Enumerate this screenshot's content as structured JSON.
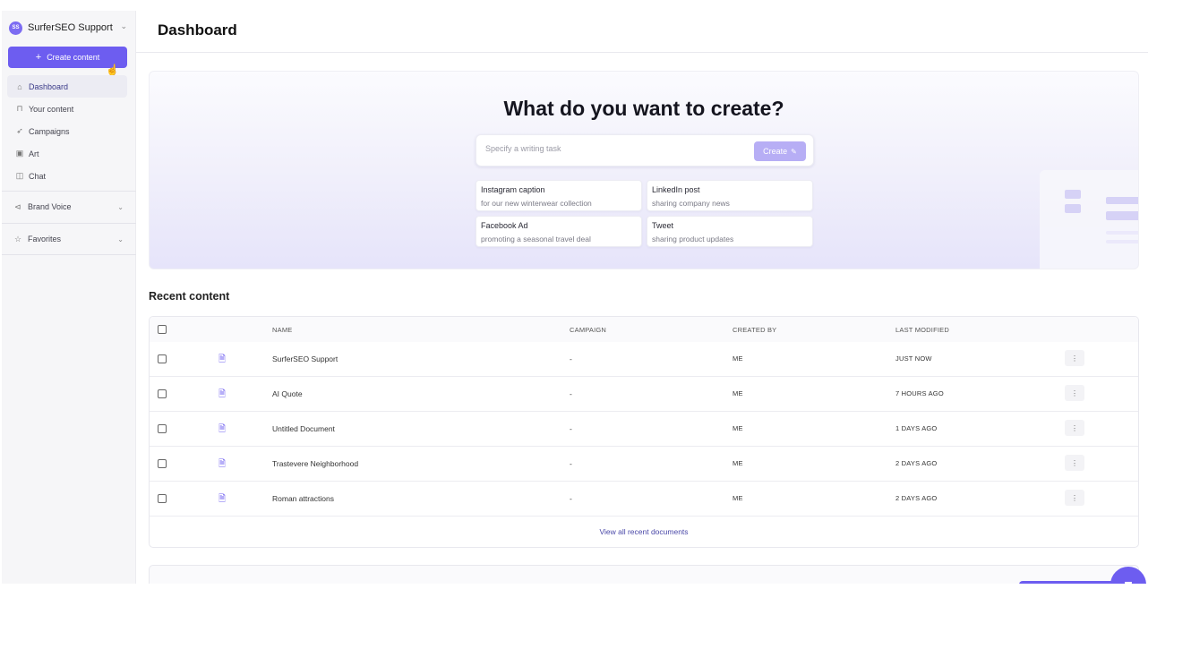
{
  "sidebar": {
    "workspace": {
      "initials": "SS",
      "name": "SurferSEO Support"
    },
    "create_button": "Create content",
    "nav": [
      {
        "label": "Dashboard",
        "icon": "home-icon",
        "glyph": "⌂"
      },
      {
        "label": "Your content",
        "icon": "lock-icon",
        "glyph": "🔒"
      },
      {
        "label": "Campaigns",
        "icon": "rocket-icon",
        "glyph": "🚀"
      },
      {
        "label": "Art",
        "icon": "image-icon",
        "glyph": "▣"
      },
      {
        "label": "Chat",
        "icon": "chat-icon",
        "glyph": "💬"
      }
    ],
    "sections": [
      {
        "label": "Brand Voice",
        "icon": "megaphone-icon"
      },
      {
        "label": "Favorites",
        "icon": "star-icon"
      }
    ]
  },
  "header": {
    "title": "Dashboard"
  },
  "hero": {
    "title": "What do you want to create?",
    "placeholder": "Specify a writing task",
    "create_label": "Create",
    "suggestions": [
      {
        "title": "Instagram caption",
        "subtitle": "for our new winterwear collection"
      },
      {
        "title": "LinkedIn post",
        "subtitle": "sharing company news"
      },
      {
        "title": "Facebook Ad",
        "subtitle": "promoting a seasonal travel deal"
      },
      {
        "title": "Tweet",
        "subtitle": "sharing product updates"
      }
    ]
  },
  "recent": {
    "title": "Recent content",
    "columns": {
      "name": "NAME",
      "campaign": "CAMPAIGN",
      "created_by": "CREATED BY",
      "last_modified": "LAST MODIFIED"
    },
    "rows": [
      {
        "name": "SurferSEO Support",
        "campaign": "-",
        "created_by": "ME",
        "last_modified": "JUST NOW"
      },
      {
        "name": "AI Quote",
        "campaign": "-",
        "created_by": "ME",
        "last_modified": "7 HOURS AGO"
      },
      {
        "name": "Untitled Document",
        "campaign": "-",
        "created_by": "ME",
        "last_modified": "1 DAYS AGO"
      },
      {
        "name": "Trastevere Neighborhood",
        "campaign": "-",
        "created_by": "ME",
        "last_modified": "2 DAYS AGO"
      },
      {
        "name": "Roman attractions",
        "campaign": "-",
        "created_by": "ME",
        "last_modified": "2 DAYS AGO"
      }
    ],
    "view_all": "View all recent documents"
  },
  "colors": {
    "accent": "#6d5df0",
    "accent_light": "#b7aef5",
    "sidebar_bg": "#f6f6f8"
  }
}
